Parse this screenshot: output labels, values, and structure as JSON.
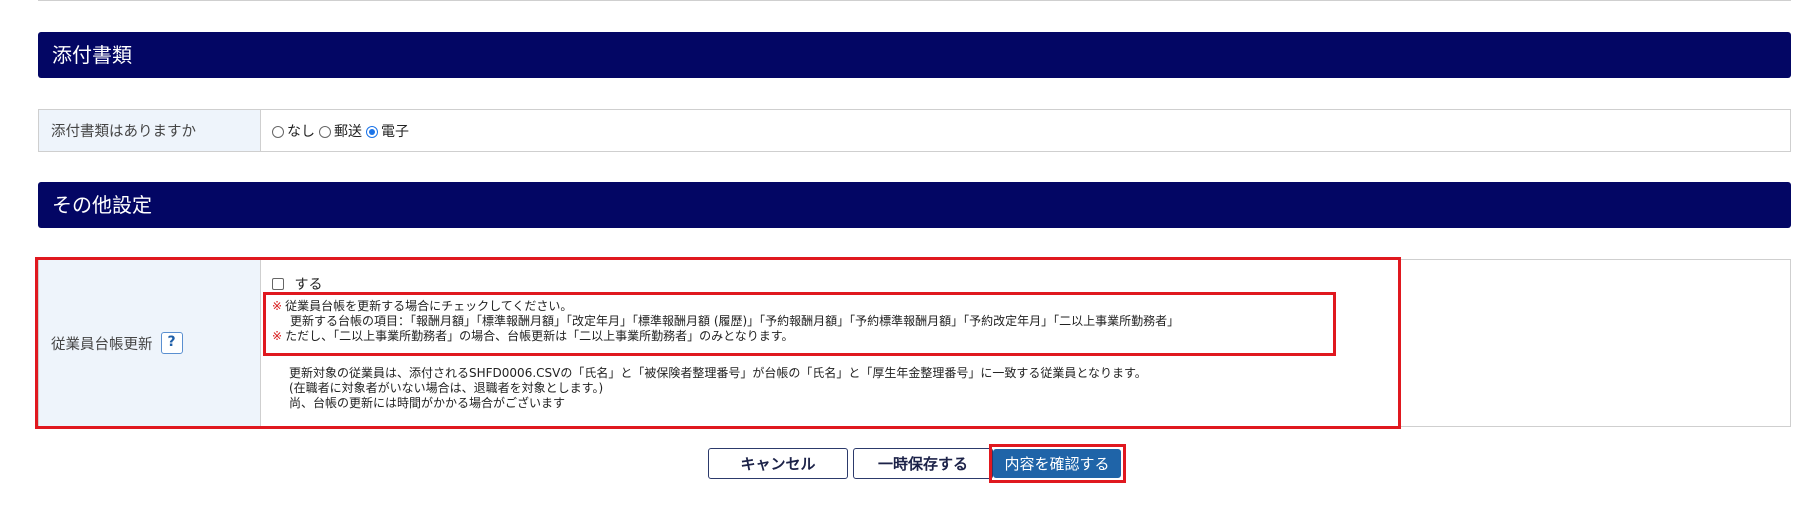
{
  "sections": {
    "attachments": {
      "title": "添付書類",
      "question_label": "添付書類はありますか",
      "options": [
        "なし",
        "郵送",
        "電子"
      ],
      "selected": "電子"
    },
    "other": {
      "title": "その他設定",
      "employee_ledger_update": {
        "label": "従業員台帳更新",
        "help": "?",
        "checkbox_label": "する",
        "checked": false,
        "note_marker": "※",
        "note_line1": "従業員台帳を更新する場合にチェックしてください。",
        "note_line2": "更新する台帳の項目：「報酬月額」「標準報酬月額」「改定年月」「標準報酬月額 (履歴)」「予約報酬月額」「予約標準報酬月額」「予約改定年月」「二以上事業所勤務者」",
        "note_line3": "ただし、「二以上事業所勤務者」の場合、台帳更新は「二以上事業所勤務者」のみとなります。",
        "info_line1": "更新対象の従業員は、添付されるSHFD0006.CSVの「氏名」と「被保険者整理番号」が台帳の「氏名」と「厚生年金整理番号」に一致する従業員となります。",
        "info_line2": "(在職者に対象者がいない場合は、退職者を対象とします。)",
        "info_line3": "尚、台帳の更新には時間がかかる場合がございます"
      }
    }
  },
  "buttons": {
    "cancel": "キャンセル",
    "save_draft": "一時保存する",
    "confirm": "内容を確認する"
  },
  "colors": {
    "section_header": "#030664",
    "label_bg": "#eef4fb",
    "primary_button": "#1f64a8",
    "highlight": "#e0181f"
  }
}
